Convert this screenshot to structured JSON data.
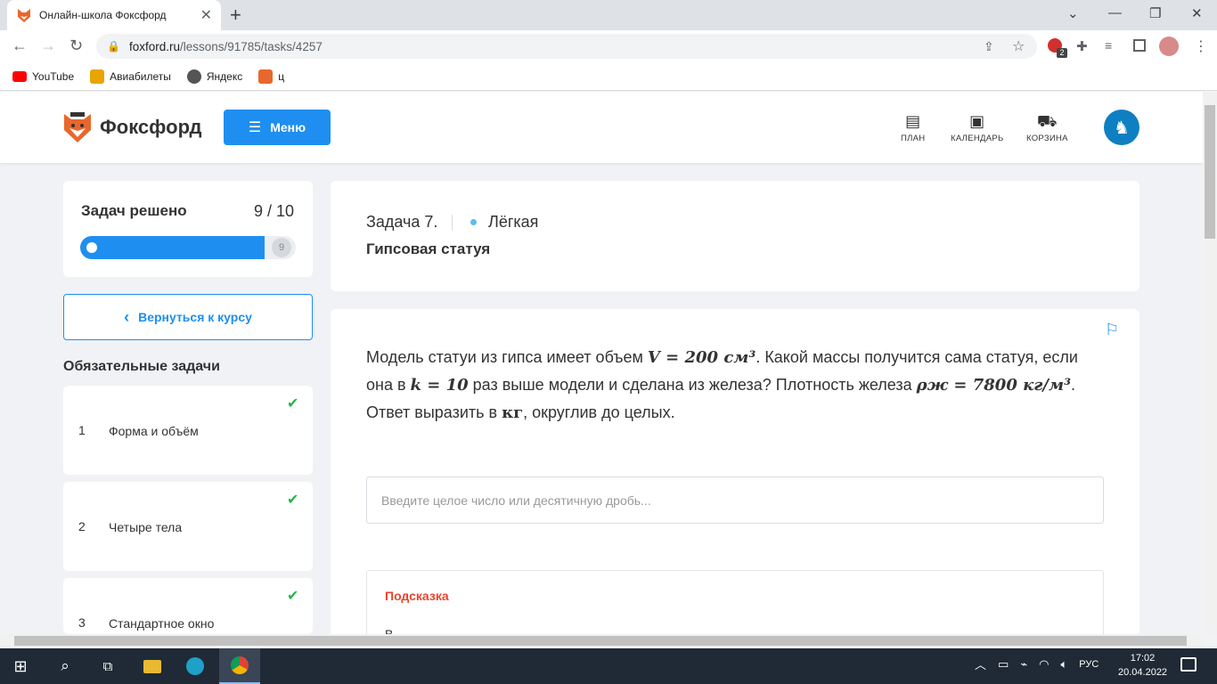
{
  "browser": {
    "tab_title": "Онлайн-школа Фоксфорд",
    "new_tab": "+",
    "url_domain": "foxford.ru",
    "url_path": "/lessons/91785/tasks/4257",
    "extension_badge": "2",
    "bookmarks": [
      {
        "label": "YouTube",
        "icon": "youtube-icon",
        "color": "#ff0000"
      },
      {
        "label": "Авиабилеты",
        "icon": "ticket-icon",
        "color": "#e8a400"
      },
      {
        "label": "Яндекс",
        "icon": "globe-icon",
        "color": "#555555"
      },
      {
        "label": "ц",
        "icon": "fox-icon",
        "color": "#e8672c"
      }
    ]
  },
  "site": {
    "brand": "Фоксфорд",
    "menu_label": "Меню",
    "nav": [
      {
        "label": "ПЛАН",
        "icon": "plan-icon"
      },
      {
        "label": "КАЛЕНДАРЬ",
        "icon": "calendar-icon"
      },
      {
        "label": "КОРЗИНА",
        "icon": "cart-icon"
      }
    ],
    "accent": "#1e8ff0"
  },
  "sidebar": {
    "progress_label": "Задач решено",
    "progress_count": "9 / 10",
    "progress_fraction": 0.9,
    "progress_end_label": "9",
    "back_label": "Вернуться к курсу",
    "section_title": "Обязательные задачи",
    "tasks": [
      {
        "num": "1",
        "name": "Форма и объём",
        "done": true
      },
      {
        "num": "2",
        "name": "Четыре тела",
        "done": true
      },
      {
        "num": "3",
        "name": "Стандартное окно",
        "done": true
      }
    ]
  },
  "task": {
    "number": "Задача 7.",
    "level": "Лёгкая",
    "title": "Гипсовая статуя",
    "problem": {
      "p1": "Модель статуи из гипса имеет объем ",
      "m1": "V = 200 см³",
      "p2": ". Какой массы получится сама статуя, если она в ",
      "m2": "k = 10",
      "p3": " раз выше модели и сделана из железа? Плотность железа ",
      "m3": "ρж = 7800 кг/м³",
      "p4": ". Ответ выразить в ",
      "m4": "кг",
      "p5": ", округлив до целых."
    },
    "answer_placeholder": "Введите целое число или десятичную дробь...",
    "hint_title": "Подсказка",
    "hint_text": "В"
  },
  "taskbar": {
    "lang": "РУС",
    "time": "17:02",
    "date": "20.04.2022"
  }
}
